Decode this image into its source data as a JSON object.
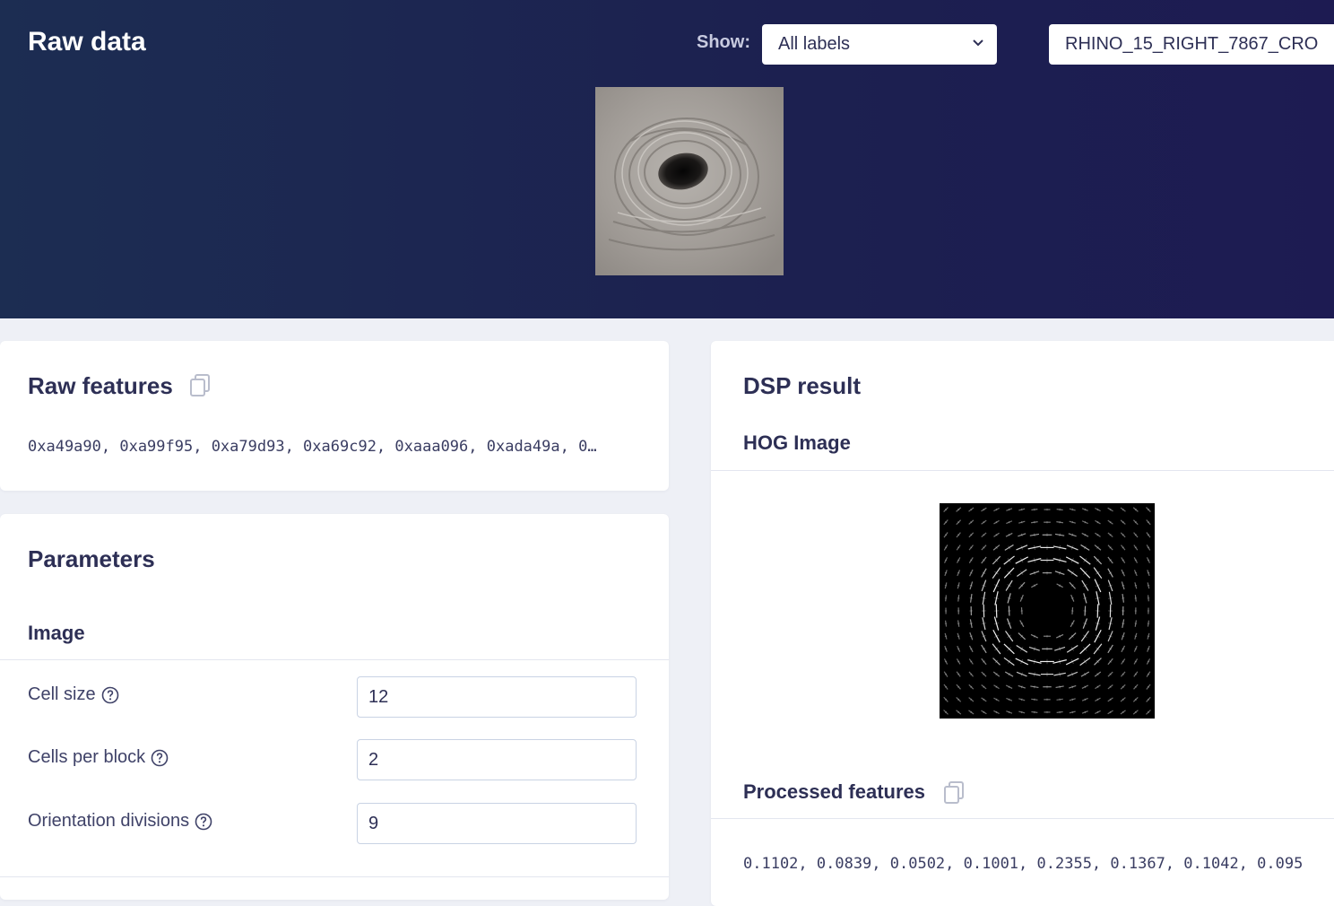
{
  "header": {
    "title": "Raw data",
    "show_label": "Show:",
    "labels_select": "All labels",
    "sample_select": "RHINO_15_RIGHT_7867_CRO"
  },
  "raw_features": {
    "title": "Raw features",
    "values": "0xa49a90, 0xa99f95, 0xa79d93, 0xa69c92, 0xaaa096, 0xada49a, 0…"
  },
  "parameters": {
    "title": "Parameters",
    "section": "Image",
    "fields": [
      {
        "label": "Cell size",
        "value": "12"
      },
      {
        "label": "Cells per block",
        "value": "2"
      },
      {
        "label": "Orientation divisions",
        "value": "9"
      }
    ]
  },
  "dsp": {
    "title": "DSP result",
    "hog_title": "HOG Image",
    "processed_title": "Processed features",
    "processed_values": "0.1102, 0.0839, 0.0502, 0.1001, 0.2355, 0.1367, 0.1042, 0.095"
  },
  "icons": {
    "copy": "copy-icon",
    "help": "help-circle-icon",
    "chevron": "chevron-down-icon"
  }
}
